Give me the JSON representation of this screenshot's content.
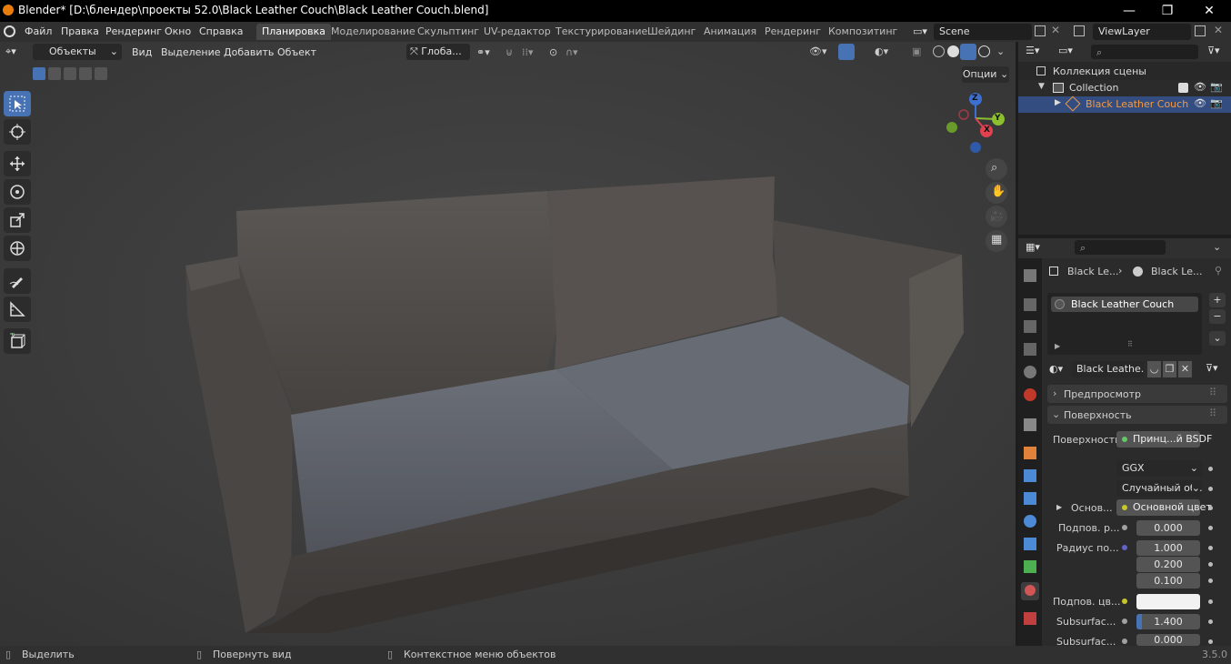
{
  "window": {
    "title": "Blender* [D:\\блендер\\проекты 52.0\\Black Leather Couch\\Black Leather Couch.blend]",
    "minimize": "—",
    "maximize": "❐",
    "close": "✕"
  },
  "menubar": {
    "items": [
      "Файл",
      "Правка",
      "Рендеринг",
      "Окно",
      "Справка"
    ],
    "workspaces": [
      "Планировка",
      "Моделирование",
      "Скульптинг",
      "UV-редактор",
      "Текстурирование",
      "Шейдинг",
      "Анимация",
      "Рендеринг",
      "Композитинг"
    ],
    "active_workspace": "Планировка",
    "scene": "Scene",
    "view_layer": "ViewLayer"
  },
  "viewport": {
    "mode": "Объекты",
    "menus": [
      "Вид",
      "Выделение",
      "Добавить",
      "Объект"
    ],
    "transform_orientation": "Глоба...",
    "options": "Опции",
    "gizmo": {
      "x": "X",
      "y": "Y",
      "z": "Z"
    }
  },
  "outliner": {
    "scene_collection": "Коллекция сцены",
    "collection": "Collection",
    "object": "Black Leather Couch"
  },
  "properties": {
    "breadcrumb_object": "Black Le...",
    "breadcrumb_material": "Black Le...",
    "material_slot": "Black Leather Couch",
    "material_name": "Black Leathe...",
    "panel_preview": "Предпросмотр",
    "panel_surface": "Поверхность",
    "surface_label": "Поверхность",
    "surface_shader": "Принц...й BSDF",
    "distribution": "GGX",
    "subsurface_method": "Случайный об...",
    "base_label": "Основ...",
    "base_color_link": "Основной цвет",
    "subsurface_weight_label": "Подпов. р...",
    "subsurface_weight": "0.000",
    "subsurface_radius_label": "Радиус по...",
    "radius_x": "1.000",
    "radius_y": "0.200",
    "radius_z": "0.100",
    "subsurface_color_label": "Подпов. цв...",
    "subsurface_ior_label": "Subsurfac...",
    "subsurface_ior": "1.400",
    "subsurface_aniso_label": "Subsurfac...",
    "subsurface_aniso": "0.000"
  },
  "statusbar": {
    "select": "Выделить",
    "rotate": "Повернуть вид",
    "context": "Контекстное меню объектов",
    "version": "3.5.0"
  },
  "colors": {
    "accent": "#4772b3",
    "highlight_row": "#334d80",
    "object_orange": "#f29a45",
    "socket_green": "#63c763",
    "socket_yellow": "#c7c729",
    "socket_blue": "#6363c7"
  }
}
